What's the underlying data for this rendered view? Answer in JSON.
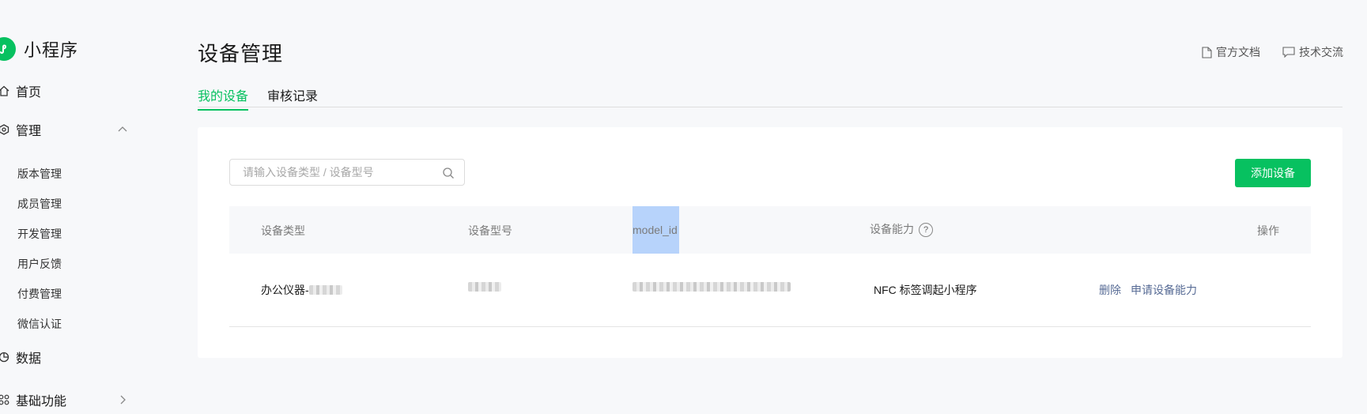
{
  "sidebar": {
    "brand": "小程序",
    "items": [
      {
        "label": "首页"
      },
      {
        "label": "管理"
      },
      {
        "label": "数据"
      },
      {
        "label": "基础功能"
      }
    ],
    "sub_items": [
      "版本管理",
      "成员管理",
      "开发管理",
      "用户反馈",
      "付费管理",
      "微信认证"
    ]
  },
  "header": {
    "title": "设备管理",
    "links": [
      {
        "label": "官方文档",
        "icon": "document-icon"
      },
      {
        "label": "技术交流",
        "icon": "chat-icon"
      }
    ]
  },
  "tabs": [
    {
      "label": "我的设备",
      "active": true
    },
    {
      "label": "审核记录",
      "active": false
    }
  ],
  "toolbar": {
    "search_placeholder": "请输入设备类型 / 设备型号",
    "add_label": "添加设备"
  },
  "table": {
    "columns": [
      "设备类型",
      "设备型号",
      "model_id",
      "设备能力",
      "操作"
    ],
    "help_glyph": "?",
    "rows": [
      {
        "type": "办公仪器-",
        "model": "",
        "model_id": "",
        "ability": "NFC 标签调起小程序",
        "actions": [
          "删除",
          "申请设备能力"
        ]
      }
    ]
  },
  "colors": {
    "accent": "#07c160",
    "link": "#576b95",
    "selection": "#b7d3fb"
  }
}
